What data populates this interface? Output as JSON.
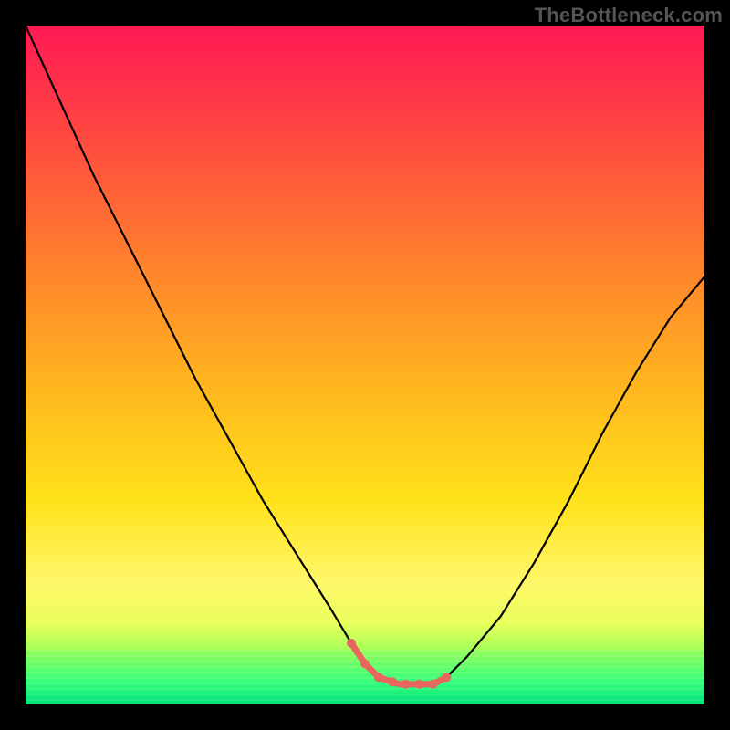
{
  "watermark": "TheBottleneck.com",
  "colors": {
    "curve": "#000000",
    "highlight": "#e8665e",
    "frame": "#000000"
  },
  "chart_data": {
    "type": "line",
    "title": "",
    "xlabel": "",
    "ylabel": "",
    "xlim": [
      0,
      100
    ],
    "ylim": [
      0,
      100
    ],
    "grid": false,
    "legend": false,
    "series": [
      {
        "name": "bottleneck-curve",
        "x": [
          0,
          5,
          10,
          15,
          20,
          25,
          30,
          35,
          40,
          45,
          48,
          50,
          52,
          55,
          58,
          60,
          62,
          65,
          70,
          75,
          80,
          85,
          90,
          95,
          100
        ],
        "y": [
          100,
          89,
          78,
          68,
          58,
          48,
          39,
          30,
          22,
          14,
          9,
          6,
          4,
          3,
          3,
          3,
          4,
          7,
          13,
          21,
          30,
          40,
          49,
          57,
          63
        ]
      }
    ],
    "highlight_region": {
      "series": "bottleneck-curve",
      "x_start": 48,
      "x_end": 62,
      "dots_x": [
        48,
        50,
        52,
        54,
        56,
        58,
        60,
        62
      ]
    },
    "background_gradient": {
      "type": "vertical",
      "stops": [
        {
          "pos": 0.0,
          "color": "#ff1a55"
        },
        {
          "pos": 0.22,
          "color": "#ff5a3a"
        },
        {
          "pos": 0.54,
          "color": "#ffb81e"
        },
        {
          "pos": 0.82,
          "color": "#fff76a"
        },
        {
          "pos": 0.93,
          "color": "#94ff5a"
        },
        {
          "pos": 1.0,
          "color": "#00e780"
        }
      ]
    }
  }
}
